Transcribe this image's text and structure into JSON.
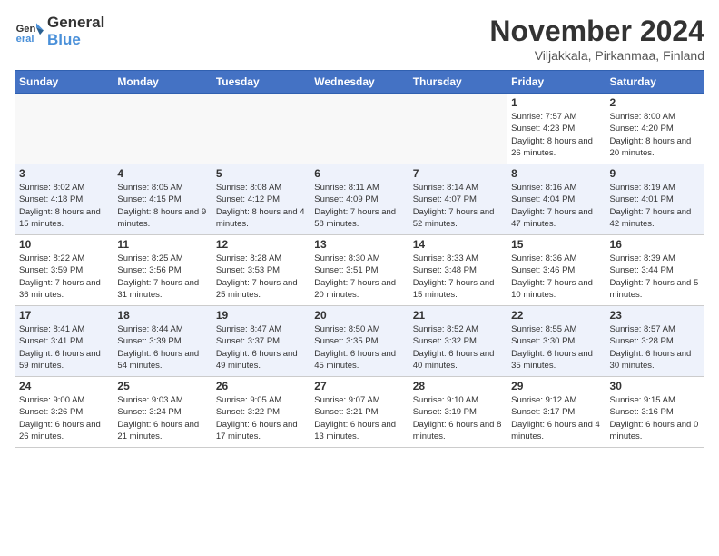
{
  "header": {
    "logo_line1": "General",
    "logo_line2": "Blue",
    "month": "November 2024",
    "location": "Viljakkala, Pirkanmaa, Finland"
  },
  "weekdays": [
    "Sunday",
    "Monday",
    "Tuesday",
    "Wednesday",
    "Thursday",
    "Friday",
    "Saturday"
  ],
  "weeks": [
    [
      {
        "day": "",
        "detail": ""
      },
      {
        "day": "",
        "detail": ""
      },
      {
        "day": "",
        "detail": ""
      },
      {
        "day": "",
        "detail": ""
      },
      {
        "day": "",
        "detail": ""
      },
      {
        "day": "1",
        "detail": "Sunrise: 7:57 AM\nSunset: 4:23 PM\nDaylight: 8 hours and 26 minutes."
      },
      {
        "day": "2",
        "detail": "Sunrise: 8:00 AM\nSunset: 4:20 PM\nDaylight: 8 hours and 20 minutes."
      }
    ],
    [
      {
        "day": "3",
        "detail": "Sunrise: 8:02 AM\nSunset: 4:18 PM\nDaylight: 8 hours and 15 minutes."
      },
      {
        "day": "4",
        "detail": "Sunrise: 8:05 AM\nSunset: 4:15 PM\nDaylight: 8 hours and 9 minutes."
      },
      {
        "day": "5",
        "detail": "Sunrise: 8:08 AM\nSunset: 4:12 PM\nDaylight: 8 hours and 4 minutes."
      },
      {
        "day": "6",
        "detail": "Sunrise: 8:11 AM\nSunset: 4:09 PM\nDaylight: 7 hours and 58 minutes."
      },
      {
        "day": "7",
        "detail": "Sunrise: 8:14 AM\nSunset: 4:07 PM\nDaylight: 7 hours and 52 minutes."
      },
      {
        "day": "8",
        "detail": "Sunrise: 8:16 AM\nSunset: 4:04 PM\nDaylight: 7 hours and 47 minutes."
      },
      {
        "day": "9",
        "detail": "Sunrise: 8:19 AM\nSunset: 4:01 PM\nDaylight: 7 hours and 42 minutes."
      }
    ],
    [
      {
        "day": "10",
        "detail": "Sunrise: 8:22 AM\nSunset: 3:59 PM\nDaylight: 7 hours and 36 minutes."
      },
      {
        "day": "11",
        "detail": "Sunrise: 8:25 AM\nSunset: 3:56 PM\nDaylight: 7 hours and 31 minutes."
      },
      {
        "day": "12",
        "detail": "Sunrise: 8:28 AM\nSunset: 3:53 PM\nDaylight: 7 hours and 25 minutes."
      },
      {
        "day": "13",
        "detail": "Sunrise: 8:30 AM\nSunset: 3:51 PM\nDaylight: 7 hours and 20 minutes."
      },
      {
        "day": "14",
        "detail": "Sunrise: 8:33 AM\nSunset: 3:48 PM\nDaylight: 7 hours and 15 minutes."
      },
      {
        "day": "15",
        "detail": "Sunrise: 8:36 AM\nSunset: 3:46 PM\nDaylight: 7 hours and 10 minutes."
      },
      {
        "day": "16",
        "detail": "Sunrise: 8:39 AM\nSunset: 3:44 PM\nDaylight: 7 hours and 5 minutes."
      }
    ],
    [
      {
        "day": "17",
        "detail": "Sunrise: 8:41 AM\nSunset: 3:41 PM\nDaylight: 6 hours and 59 minutes."
      },
      {
        "day": "18",
        "detail": "Sunrise: 8:44 AM\nSunset: 3:39 PM\nDaylight: 6 hours and 54 minutes."
      },
      {
        "day": "19",
        "detail": "Sunrise: 8:47 AM\nSunset: 3:37 PM\nDaylight: 6 hours and 49 minutes."
      },
      {
        "day": "20",
        "detail": "Sunrise: 8:50 AM\nSunset: 3:35 PM\nDaylight: 6 hours and 45 minutes."
      },
      {
        "day": "21",
        "detail": "Sunrise: 8:52 AM\nSunset: 3:32 PM\nDaylight: 6 hours and 40 minutes."
      },
      {
        "day": "22",
        "detail": "Sunrise: 8:55 AM\nSunset: 3:30 PM\nDaylight: 6 hours and 35 minutes."
      },
      {
        "day": "23",
        "detail": "Sunrise: 8:57 AM\nSunset: 3:28 PM\nDaylight: 6 hours and 30 minutes."
      }
    ],
    [
      {
        "day": "24",
        "detail": "Sunrise: 9:00 AM\nSunset: 3:26 PM\nDaylight: 6 hours and 26 minutes."
      },
      {
        "day": "25",
        "detail": "Sunrise: 9:03 AM\nSunset: 3:24 PM\nDaylight: 6 hours and 21 minutes."
      },
      {
        "day": "26",
        "detail": "Sunrise: 9:05 AM\nSunset: 3:22 PM\nDaylight: 6 hours and 17 minutes."
      },
      {
        "day": "27",
        "detail": "Sunrise: 9:07 AM\nSunset: 3:21 PM\nDaylight: 6 hours and 13 minutes."
      },
      {
        "day": "28",
        "detail": "Sunrise: 9:10 AM\nSunset: 3:19 PM\nDaylight: 6 hours and 8 minutes."
      },
      {
        "day": "29",
        "detail": "Sunrise: 9:12 AM\nSunset: 3:17 PM\nDaylight: 6 hours and 4 minutes."
      },
      {
        "day": "30",
        "detail": "Sunrise: 9:15 AM\nSunset: 3:16 PM\nDaylight: 6 hours and 0 minutes."
      }
    ]
  ]
}
